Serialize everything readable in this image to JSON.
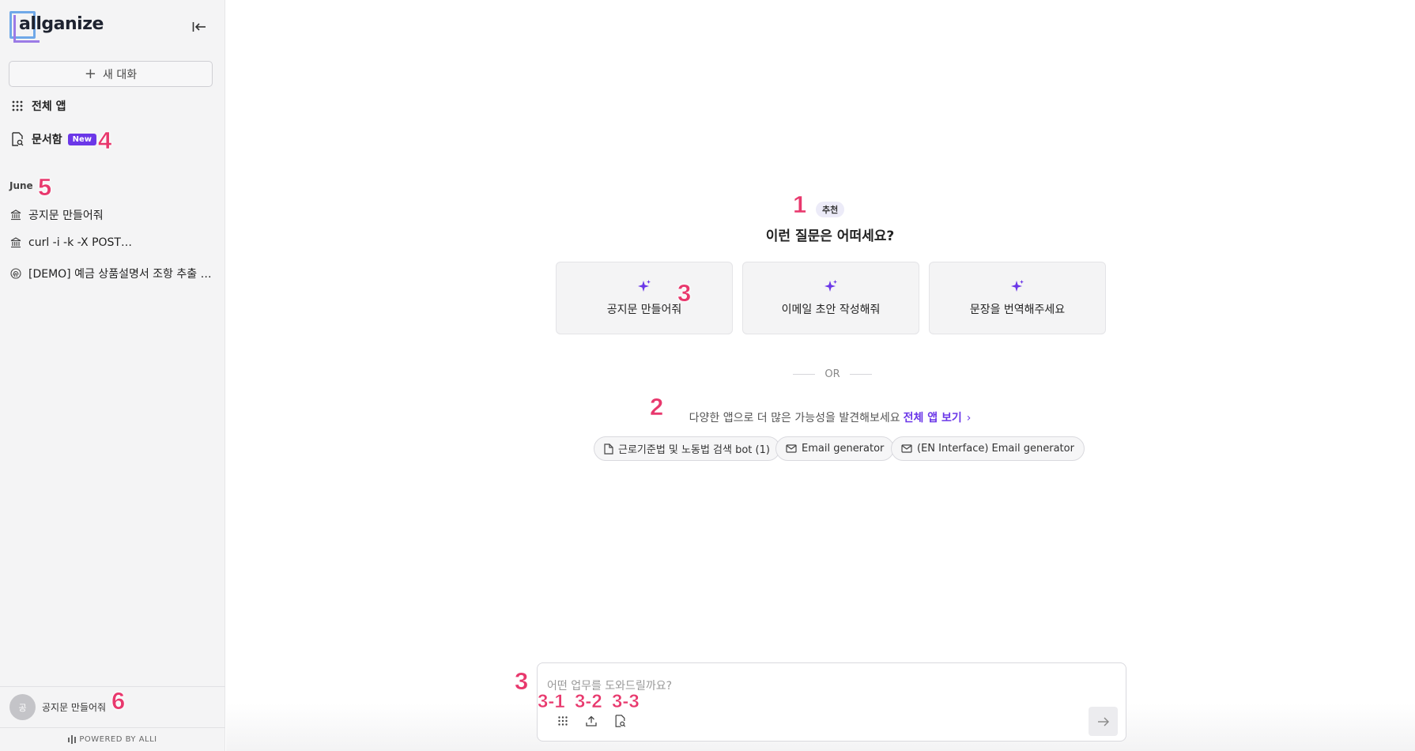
{
  "brand": {
    "logo_text": "allganize"
  },
  "sidebar": {
    "new_chat_label": "새 대화",
    "all_apps_label": "전체 앱",
    "docbox_label": "문서함",
    "docbox_badge": "New",
    "section_label": "June",
    "history": [
      {
        "label": "공지문 만들어줘",
        "icon": "bank-icon"
      },
      {
        "label": "curl -i -k -X POST…",
        "icon": "bank-icon"
      },
      {
        "label": "[DEMO] 예금 상품설명서 조항 추출 및…",
        "icon": "fingerprint-icon"
      }
    ],
    "user": {
      "avatar_letter": "공",
      "name": "공지문 만들어줘"
    },
    "powered_by": "POWERED BY ALLI"
  },
  "main": {
    "recommend_badge": "추천",
    "question": "이런 질문은 어떠세요?",
    "suggestions": [
      "공지문 만들어줘",
      "이메일 초안 작성해줘",
      "문장을 번역해주세요"
    ],
    "or_label": "OR",
    "discover_text": "다양한 앱으로 더 많은 가능성을 발견해보세요",
    "discover_link": "전체 앱 보기",
    "apps": [
      {
        "label": "근로기준법 및 노동법 검색 bot (1)",
        "icon": "document-icon"
      },
      {
        "label": "Email generator",
        "icon": "mail-icon"
      },
      {
        "label": "(EN Interface) Email generator",
        "icon": "mail-icon"
      }
    ]
  },
  "composer": {
    "placeholder": "어떤 업무를 도와드릴까요?"
  },
  "annotations": {
    "a1": "1",
    "a2": "2",
    "a3": "3",
    "a3b": "3",
    "a31": "3-1",
    "a32": "3-2",
    "a33": "3-3",
    "a4": "4",
    "a5": "5",
    "a6": "6"
  },
  "colors": {
    "accent": "#6b37e8",
    "annotation": "#e8386d",
    "sidebar_bg": "#f4f4f5"
  }
}
